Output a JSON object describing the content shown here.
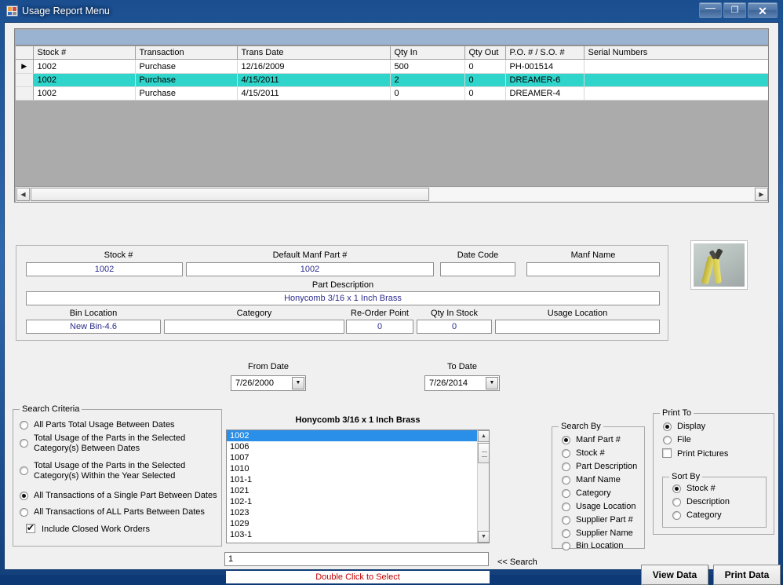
{
  "window": {
    "title": "Usage Report Menu",
    "icon": "form-icon",
    "controls": {
      "minimize": "–",
      "maximize": "❐",
      "close": "✕"
    }
  },
  "grid": {
    "columns": [
      "Stock #",
      "Transaction",
      "Trans Date",
      "Qty In",
      "Qty Out",
      "P.O. # / S.O. #",
      "Serial Numbers"
    ],
    "rows": [
      {
        "marker": "▶",
        "selected": false,
        "cells": [
          "1002",
          "Purchase",
          "12/16/2009",
          "500",
          "0",
          "PH-001514",
          ""
        ]
      },
      {
        "marker": "",
        "selected": true,
        "cells": [
          "1002",
          "Purchase",
          "4/15/2011",
          "2",
          "0",
          "DREAMER-6",
          ""
        ]
      },
      {
        "marker": "",
        "selected": false,
        "cells": [
          "1002",
          "Purchase",
          "4/15/2011",
          "0",
          "0",
          "DREAMER-4",
          ""
        ]
      }
    ],
    "scroll": {
      "left_arrow": "◀",
      "right_arrow": "▶"
    },
    "selection_color": "#2fd4cb"
  },
  "detail": {
    "stock_number": {
      "label": "Stock #",
      "value": "1002"
    },
    "default_manf_part": {
      "label": "Default Manf Part #",
      "value": "1002"
    },
    "date_code": {
      "label": "Date Code",
      "value": ""
    },
    "manf_name": {
      "label": "Manf Name",
      "value": ""
    },
    "part_description": {
      "label": "Part Description",
      "value": "Honycomb 3/16 x 1 Inch Brass"
    },
    "bin_location": {
      "label": "Bin Location",
      "value": "New Bin-4.6"
    },
    "category": {
      "label": "Category",
      "value": ""
    },
    "reorder_point": {
      "label": "Re-Order Point",
      "value": "0"
    },
    "qty_in_stock": {
      "label": "Qty In Stock",
      "value": "0"
    },
    "usage_location": {
      "label": "Usage Location",
      "value": ""
    },
    "picture": "part-photo-pliers"
  },
  "dates": {
    "from": {
      "label": "From Date",
      "value": "7/26/2000"
    },
    "to": {
      "label": "To Date",
      "value": "7/26/2014"
    },
    "dropdown_glyph": "▼"
  },
  "search_criteria": {
    "title": "Search Criteria",
    "options": [
      {
        "label": "All Parts Total Usage Between Dates",
        "selected": false
      },
      {
        "label": "Total Usage of the Parts in the Selected Category(s) Between Dates",
        "selected": false
      },
      {
        "label": "Total Usage of the Parts in the Selected Category(s) Within the Year Selected",
        "selected": false
      },
      {
        "label": "All Transactions of a Single Part Between Dates",
        "selected": true
      },
      {
        "label": "All Transactions of ALL Parts Between Dates",
        "selected": false
      }
    ],
    "include_closed": {
      "label": "Include Closed Work Orders",
      "checked": true
    }
  },
  "parts_list": {
    "title": "Honycomb 3/16 x 1 Inch Brass",
    "items": [
      "1002",
      "1006",
      "1007",
      "1010",
      "101-1",
      "1021",
      "102-1",
      "1023",
      "1029",
      "103-1"
    ],
    "selected_index": 0,
    "scroll": {
      "up_arrow": "▲",
      "down_arrow": "▼"
    }
  },
  "search": {
    "value": "1",
    "placeholder": "",
    "link_label": "<< Search",
    "hint": "Double Click to Select"
  },
  "search_by": {
    "title": "Search By",
    "options": [
      {
        "label": "Manf Part #",
        "selected": true
      },
      {
        "label": "Stock #",
        "selected": false
      },
      {
        "label": "Part Description",
        "selected": false
      },
      {
        "label": "Manf Name",
        "selected": false
      },
      {
        "label": "Category",
        "selected": false
      },
      {
        "label": "Usage Location",
        "selected": false
      },
      {
        "label": "Supplier Part #",
        "selected": false
      },
      {
        "label": "Supplier Name",
        "selected": false
      },
      {
        "label": "Bin Location",
        "selected": false
      }
    ]
  },
  "print_to": {
    "title": "Print To",
    "options": [
      {
        "label": "Display",
        "selected": true
      },
      {
        "label": "File",
        "selected": false
      }
    ],
    "print_pictures": {
      "label": "Print Pictures",
      "checked": false
    },
    "sort_by": {
      "title": "Sort By",
      "options": [
        {
          "label": "Stock #",
          "selected": true
        },
        {
          "label": "Description",
          "selected": false
        },
        {
          "label": "Category",
          "selected": false
        }
      ]
    }
  },
  "actions": {
    "view_data": "View Data",
    "print_data": "Print Data"
  }
}
